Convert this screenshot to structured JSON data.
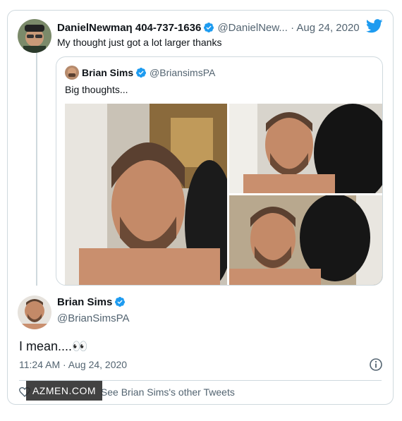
{
  "parent_tweet": {
    "display_name": "DanielNewmaη 404-737-1636",
    "handle": "@DanielNew...",
    "separator": "·",
    "date": "Aug 24, 2020",
    "text": "My thought just got a lot larger thanks"
  },
  "quoted_tweet": {
    "display_name": "Brian Sims",
    "handle": "@BriansimsPA",
    "text": "Big thoughts..."
  },
  "main_tweet": {
    "display_name": "Brian Sims",
    "handle": "@BrianSimsPA",
    "text": "I mean....👀",
    "timestamp": "11:24 AM · Aug 24, 2020"
  },
  "footer": {
    "see_more_label": "See Brian Sims's other Tweets"
  },
  "watermark": {
    "text": "AZMEN.COM"
  },
  "colors": {
    "accent": "#1d9bf0",
    "border": "#cfd9de",
    "muted": "#536471",
    "text": "#0f1419"
  },
  "icons": {
    "verified": "verified-badge-icon",
    "brand": "twitter-bird-icon",
    "info": "info-icon",
    "like": "heart-icon"
  }
}
